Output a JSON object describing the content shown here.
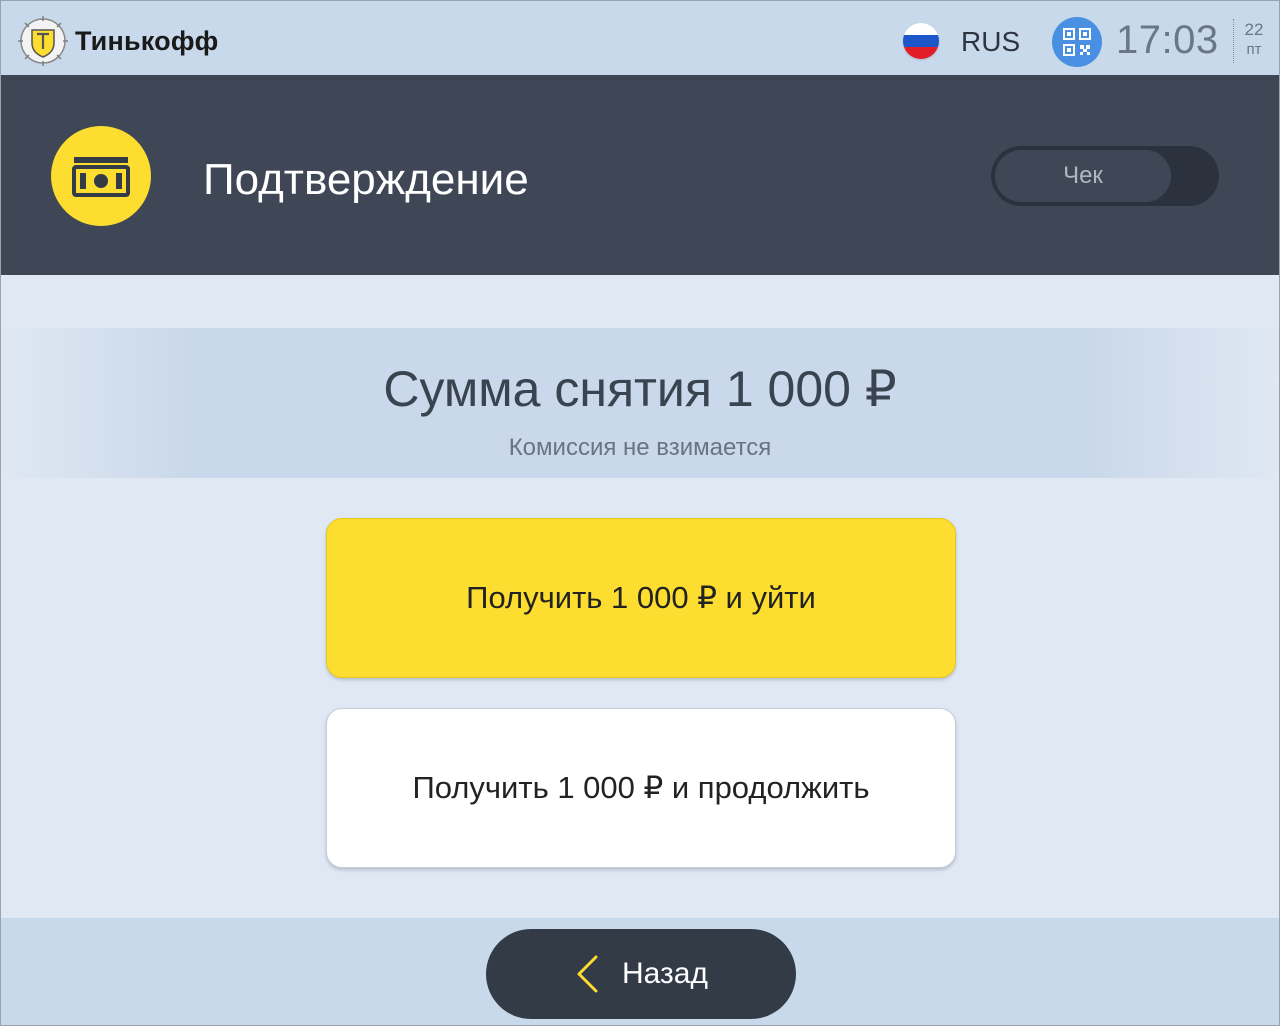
{
  "topbar": {
    "brand_name": "Тинькофф",
    "language": "RUS",
    "time": "17:03",
    "date_day": "22",
    "date_weekday": "пт"
  },
  "header": {
    "title": "Подтверждение",
    "receipt_toggle_label": "Чек"
  },
  "amount": {
    "title": "Сумма снятия 1 000 ₽",
    "note": "Комиссия не взимается"
  },
  "actions": {
    "primary_label": "Получить 1 000 ₽ и уйти",
    "secondary_label": "Получить 1 000 ₽ и продолжить"
  },
  "footer": {
    "back_label": "Назад"
  },
  "icons": {
    "logo": "tinkoff-logo",
    "flag": "russia-flag-icon",
    "qr": "qr-code-icon",
    "header": "cash-icon",
    "back": "chevron-left-icon"
  },
  "colors": {
    "accent_yellow": "#fddd2f",
    "header_dark": "#3f4756",
    "bar_light": "#c8d9ec",
    "qr_blue": "#4a90e2",
    "back_button": "#333b47"
  }
}
